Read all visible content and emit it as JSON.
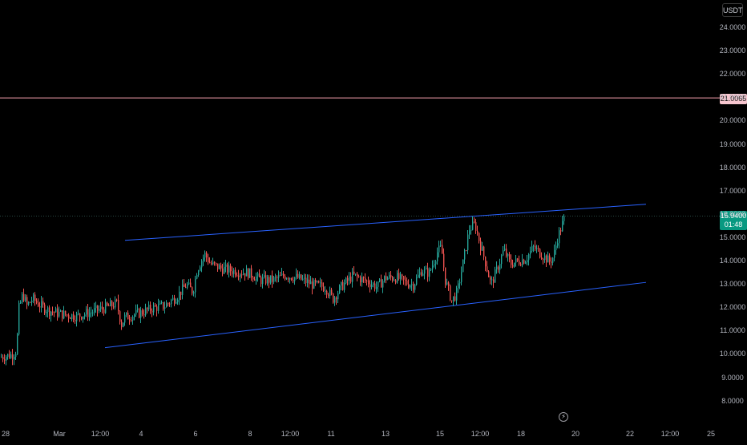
{
  "currency": "USDT",
  "horizontal_line": {
    "price": 21.0065,
    "label": "21.0065",
    "color": "#f7a1ae"
  },
  "last_price": {
    "label": "15.9400",
    "countdown": "01:48",
    "color": "#089981"
  },
  "colors": {
    "up": "#26a69a",
    "down": "#ef5350",
    "channel": "#2962ff",
    "background": "#000000",
    "axis_text": "#b2b5be"
  },
  "status_icon": "lightning-bolt-icon",
  "chart_data": {
    "type": "candlestick",
    "ylim": [
      7.6,
      24.55
    ],
    "y_ticks": [
      "24.0000",
      "23.0000",
      "22.0000",
      "21.0000",
      "20.0000",
      "19.0000",
      "18.0000",
      "17.0000",
      "16.0000",
      "15.0000",
      "14.0000",
      "13.0000",
      "12.0000",
      "11.0000",
      "10.0000",
      "9.0000",
      "8.0000"
    ],
    "x_ticks": [
      "28",
      "Mar",
      "12:00",
      "4",
      "6",
      "8",
      "12:00",
      "11",
      "13",
      "15",
      "12:00",
      "18",
      "20",
      "22",
      "12:00",
      "25"
    ],
    "price_path_anchors": [
      [
        0,
        9.9
      ],
      [
        15,
        10.0
      ],
      [
        20,
        10.2
      ],
      [
        23,
        12.0
      ],
      [
        28,
        12.6
      ],
      [
        33,
        12.1
      ],
      [
        40,
        12.4
      ],
      [
        50,
        12.1
      ],
      [
        60,
        11.9
      ],
      [
        75,
        11.75
      ],
      [
        95,
        11.65
      ],
      [
        110,
        11.8
      ],
      [
        130,
        12.0
      ],
      [
        145,
        12.2
      ],
      [
        151,
        11.3
      ],
      [
        155,
        11.6
      ],
      [
        165,
        11.7
      ],
      [
        175,
        11.8
      ],
      [
        190,
        12.0
      ],
      [
        205,
        12.1
      ],
      [
        220,
        12.5
      ],
      [
        232,
        13.0
      ],
      [
        240,
        12.7
      ],
      [
        245,
        13.6
      ],
      [
        250,
        14.0
      ],
      [
        255,
        14.3
      ],
      [
        262,
        13.9
      ],
      [
        275,
        13.7
      ],
      [
        290,
        13.6
      ],
      [
        310,
        13.5
      ],
      [
        325,
        13.2
      ],
      [
        340,
        13.2
      ],
      [
        355,
        13.4
      ],
      [
        370,
        13.3
      ],
      [
        390,
        13.0
      ],
      [
        405,
        12.9
      ],
      [
        415,
        12.4
      ],
      [
        425,
        12.9
      ],
      [
        440,
        13.4
      ],
      [
        460,
        13.1
      ],
      [
        470,
        12.9
      ],
      [
        480,
        13.3
      ],
      [
        495,
        13.3
      ],
      [
        505,
        13.1
      ],
      [
        515,
        13.0
      ],
      [
        525,
        13.6
      ],
      [
        535,
        13.5
      ],
      [
        545,
        14.4
      ],
      [
        550,
        14.6
      ],
      [
        555,
        13.2
      ],
      [
        563,
        12.3
      ],
      [
        570,
        12.7
      ],
      [
        578,
        14.1
      ],
      [
        585,
        15.4
      ],
      [
        592,
        15.6
      ],
      [
        598,
        14.8
      ],
      [
        604,
        14.1
      ],
      [
        612,
        13.0
      ],
      [
        620,
        13.7
      ],
      [
        628,
        14.5
      ],
      [
        636,
        13.9
      ],
      [
        645,
        14.0
      ],
      [
        655,
        14.1
      ],
      [
        665,
        14.6
      ],
      [
        675,
        14.3
      ],
      [
        685,
        14.0
      ],
      [
        690,
        14.2
      ],
      [
        695,
        15.0
      ],
      [
        700,
        15.5
      ],
      [
        704,
        15.9
      ]
    ],
    "horizontal_level": 21.0065,
    "last_close": 15.94,
    "channel_upper": {
      "from": [
        "2/29",
        14.9
      ],
      "to": [
        "3/22",
        16.45
      ]
    },
    "channel_lower": {
      "from": [
        "2/28",
        10.3
      ],
      "to": [
        "3/22",
        13.1
      ]
    }
  }
}
